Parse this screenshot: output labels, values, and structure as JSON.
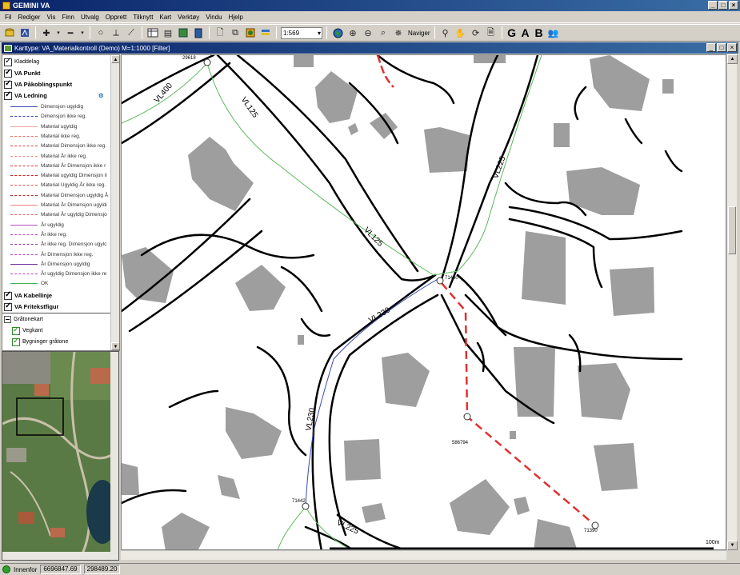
{
  "app": {
    "title": "GEMINI VA"
  },
  "menu": [
    "Fil",
    "Rediger",
    "Vis",
    "Finn",
    "Utvalg",
    "Opprett",
    "Tilknytt",
    "Kart",
    "Verktøy",
    "Vindu",
    "Hjelp"
  ],
  "toolbar": {
    "scale": "1:569",
    "navigate_label": "Naviger",
    "g": "G",
    "a": "A",
    "b": "B"
  },
  "map_window": {
    "title": "Karttype: VA_Materialkontroll (Demo) M=1:1000 [Filter]"
  },
  "layers": [
    {
      "label": "Kladdelag",
      "checked": true,
      "bold": false
    },
    {
      "label": "VA Punkt",
      "checked": true,
      "bold": true
    },
    {
      "label": "VA Påkoblingspunkt",
      "checked": true,
      "bold": true
    },
    {
      "label": "VA Ledning",
      "checked": true,
      "bold": true
    }
  ],
  "legend": [
    {
      "label": "Dimensjon ugyldig",
      "color": "#3a4ab8",
      "style": "solid"
    },
    {
      "label": "Dimensjon ikke reg.",
      "color": "#3a4ab8",
      "style": "dashed"
    },
    {
      "label": "Material ugyldig",
      "color": "#f4a0a0",
      "style": "solid"
    },
    {
      "label": "Material ikke reg.",
      "color": "#f07060",
      "style": "dashed"
    },
    {
      "label": "Material Dimensjon ikke reg.",
      "color": "#e04040",
      "style": "dashed"
    },
    {
      "label": "Material År ikke reg.",
      "color": "#f09090",
      "style": "dashed"
    },
    {
      "label": "Material År Dimensjon ikke r",
      "color": "#e03030",
      "style": "dashed"
    },
    {
      "label": "Material ugyldig Dimensjon il",
      "color": "#d02020",
      "style": "dashed"
    },
    {
      "label": "Material Ugyldig År ikke reg.",
      "color": "#e05050",
      "style": "dashed"
    },
    {
      "label": "Material Dimensjon ugyldig Å",
      "color": "#a03030",
      "style": "dashed"
    },
    {
      "label": "Material År Dimensjon ugyldi",
      "color": "#f08080",
      "style": "solid"
    },
    {
      "label": "Material År ugyldig Dimensjo",
      "color": "#e06060",
      "style": "dashed"
    },
    {
      "label": "År ugyldig",
      "color": "#b050c0",
      "style": "solid"
    },
    {
      "label": "År ikke reg.",
      "color": "#b050c0",
      "style": "dashed"
    },
    {
      "label": "År ikke reg. Dimensjon ugylc",
      "color": "#9040a0",
      "style": "dashed"
    },
    {
      "label": "År Dimensjon ikke reg.",
      "color": "#c040c0",
      "style": "dashed"
    },
    {
      "label": "År Dimensjon ugyldig",
      "color": "#7030a0",
      "style": "solid"
    },
    {
      "label": "År ugyldig Dimensjon ikke re",
      "color": "#c040c0",
      "style": "dashed"
    },
    {
      "label": "OK",
      "color": "#4caf50",
      "style": "solid"
    }
  ],
  "layers2": [
    {
      "label": "VA Kabellinje",
      "checked": true,
      "bold": true
    },
    {
      "label": "VA Fritekstfigur",
      "checked": true,
      "bold": true
    }
  ],
  "group": {
    "label": "Gråtonekart"
  },
  "sublayers": [
    {
      "label": "Vegkant",
      "checked": true
    },
    {
      "label": "Bygninger gråtone",
      "checked": true
    }
  ],
  "map_labels": {
    "pipes": [
      "VL400",
      "VL125",
      "VL225",
      "VL125",
      "VL230",
      "VL230",
      "VL225"
    ],
    "points": [
      "29618",
      "71440",
      "586794",
      "71390",
      "71442"
    ],
    "scale_text": "100m"
  },
  "status": {
    "mode": "Innenfor",
    "x": "6696847.69",
    "y": "298489.20"
  }
}
